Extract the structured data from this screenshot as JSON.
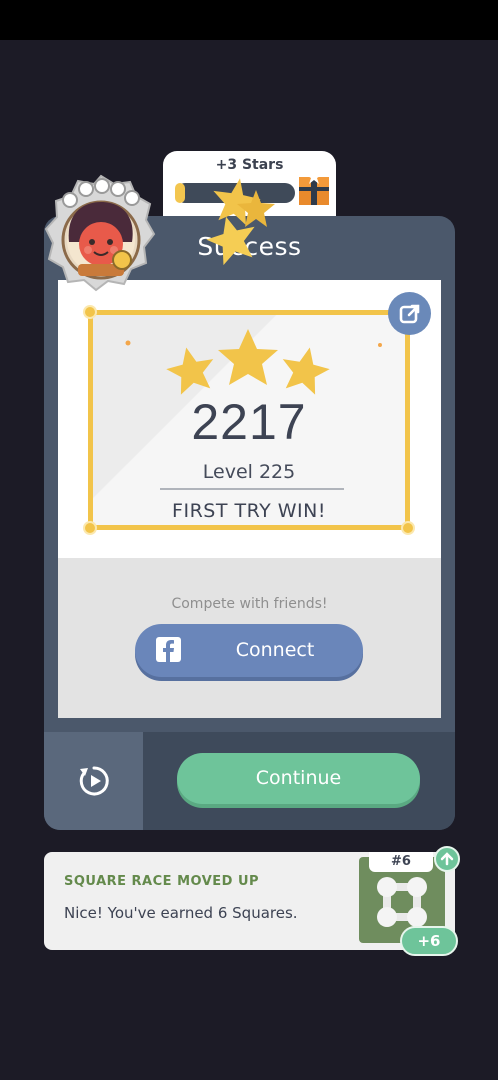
{
  "rewards_tab": {
    "label": "+3 Stars",
    "progress": 0.08
  },
  "result_card": {
    "title": "Success",
    "score": "2217",
    "level": "Level 225",
    "achievement": "FIRST TRY WIN!",
    "stars_earned": 3,
    "share_icon": "share-external-icon"
  },
  "social": {
    "prompt": "Compete with friends!",
    "connect_label": "Connect",
    "icon": "facebook-icon"
  },
  "actions": {
    "continue_label": "Continue",
    "replay_icon": "replay-icon"
  },
  "race": {
    "title": "SQUARE RACE MOVED UP",
    "message": "Nice! You've earned 6 Squares.",
    "rank": "#6",
    "bonus": "+6"
  },
  "colors": {
    "background": "#1c1b26",
    "card": "#4b586b",
    "gold": "#f2c44a",
    "facebook": "#6a86ba",
    "continue": "#6ec49a",
    "race_green": "#648a4c"
  }
}
